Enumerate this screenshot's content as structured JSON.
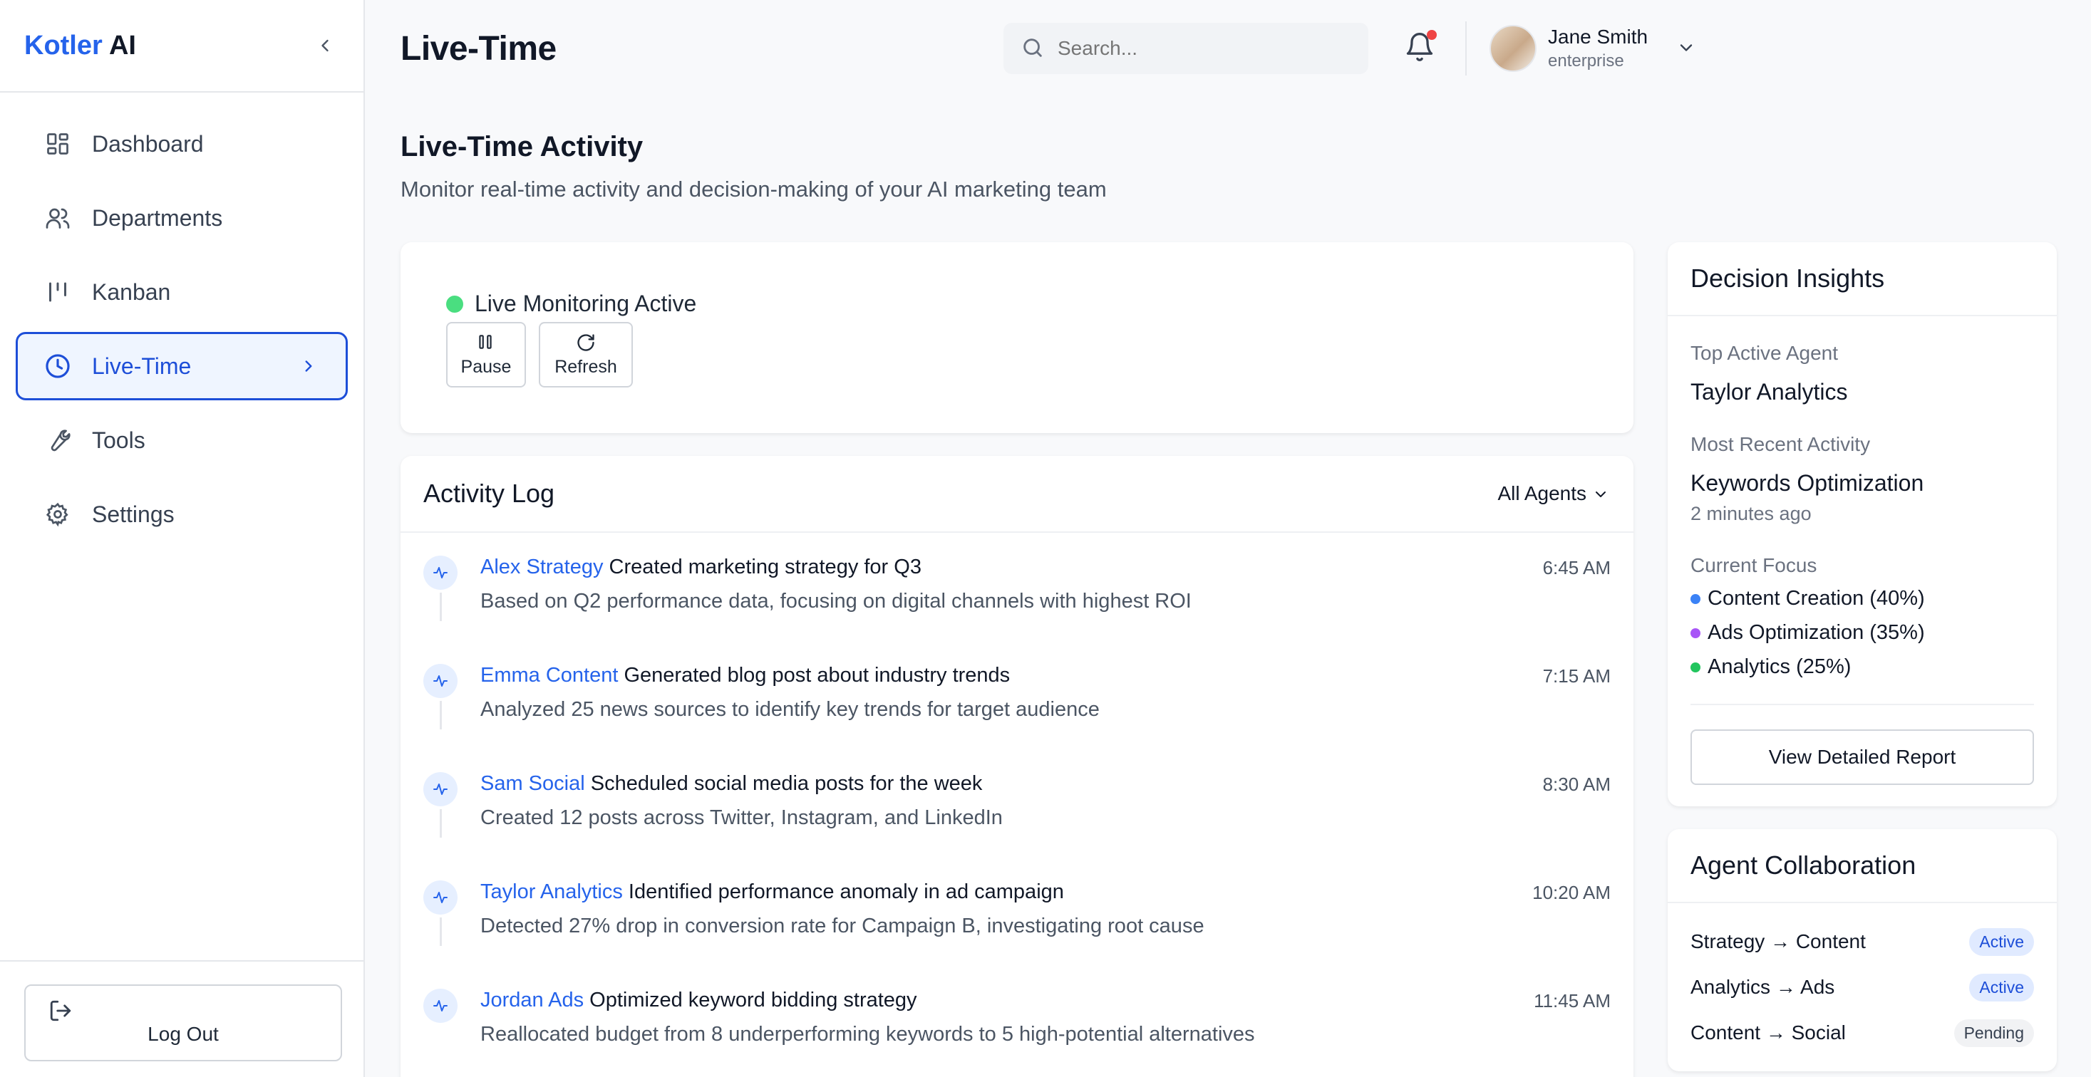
{
  "brand": {
    "name_part1": "Kotler",
    "name_part2": "AI"
  },
  "sidebar": {
    "items": [
      {
        "label": "Dashboard",
        "icon": "dashboard-icon"
      },
      {
        "label": "Departments",
        "icon": "users-icon"
      },
      {
        "label": "Kanban",
        "icon": "kanban-icon"
      },
      {
        "label": "Live-Time",
        "icon": "clock-icon",
        "active": true
      },
      {
        "label": "Tools",
        "icon": "wrench-icon"
      },
      {
        "label": "Settings",
        "icon": "gear-icon"
      }
    ],
    "logout_label": "Log Out"
  },
  "header": {
    "title": "Live-Time",
    "search_placeholder": "Search...",
    "user": {
      "name": "Jane Smith",
      "plan": "enterprise"
    }
  },
  "main": {
    "title": "Live-Time Activity",
    "subtitle": "Monitor real-time activity and decision-making of your AI marketing team",
    "monitor": {
      "status": "Live Monitoring Active",
      "pause_label": "Pause",
      "refresh_label": "Refresh"
    },
    "log": {
      "title": "Activity Log",
      "filter": "All Agents",
      "items": [
        {
          "agent": "Alex Strategy",
          "action": "Created marketing strategy for Q3",
          "desc": "Based on Q2 performance data, focusing on digital channels with highest ROI",
          "time": "6:45 AM"
        },
        {
          "agent": "Emma Content",
          "action": "Generated blog post about industry trends",
          "desc": "Analyzed 25 news sources to identify key trends for target audience",
          "time": "7:15 AM"
        },
        {
          "agent": "Sam Social",
          "action": "Scheduled social media posts for the week",
          "desc": "Created 12 posts across Twitter, Instagram, and LinkedIn",
          "time": "8:30 AM"
        },
        {
          "agent": "Taylor Analytics",
          "action": "Identified performance anomaly in ad campaign",
          "desc": "Detected 27% drop in conversion rate for Campaign B, investigating root cause",
          "time": "10:20 AM"
        },
        {
          "agent": "Jordan Ads",
          "action": "Optimized keyword bidding strategy",
          "desc": "Reallocated budget from 8 underperforming keywords to 5 high-potential alternatives",
          "time": "11:45 AM"
        }
      ]
    }
  },
  "insights": {
    "title": "Decision Insights",
    "top_agent_label": "Top Active Agent",
    "top_agent": "Taylor Analytics",
    "recent_label": "Most Recent Activity",
    "recent_activity": "Keywords Optimization",
    "recent_time": "2 minutes ago",
    "focus_label": "Current Focus",
    "focus": [
      {
        "label": "Content Creation (40%)",
        "color": "#3b82f6"
      },
      {
        "label": "Ads Optimization (35%)",
        "color": "#a855f7"
      },
      {
        "label": "Analytics (25%)",
        "color": "#22c55e"
      }
    ],
    "report_button": "View Detailed Report"
  },
  "collaboration": {
    "title": "Agent Collaboration",
    "rows": [
      {
        "pair": "Strategy → Content",
        "status": "Active"
      },
      {
        "pair": "Analytics → Ads",
        "status": "Active"
      },
      {
        "pair": "Content → Social",
        "status": "Pending"
      }
    ]
  },
  "colors": {
    "accent": "#2563eb",
    "live": "#4ade80",
    "notification": "#ef4444"
  }
}
